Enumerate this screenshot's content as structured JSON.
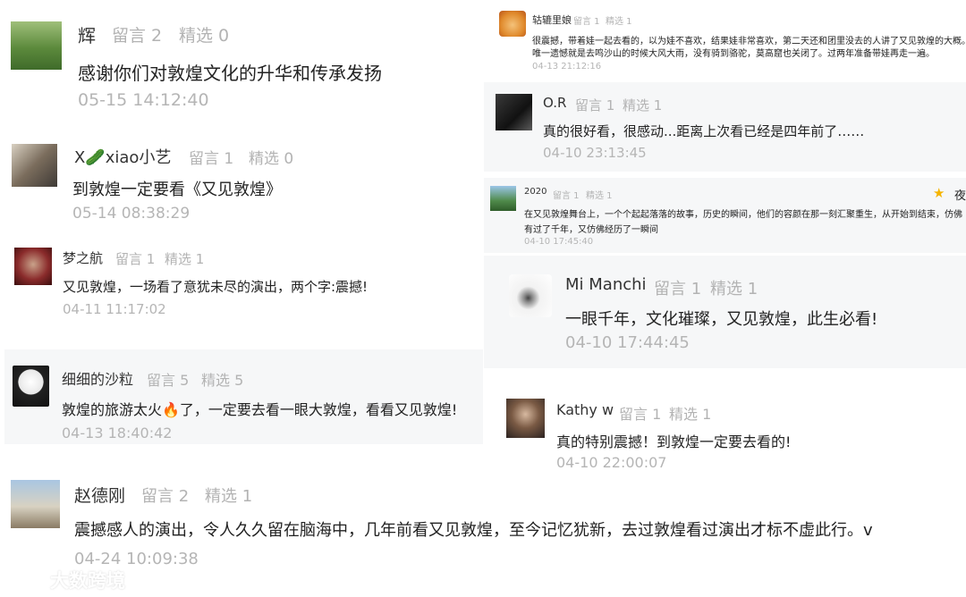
{
  "comments": [
    {
      "name": "辉",
      "meta_msgs": "留言 2",
      "meta_sel": "精选 0",
      "text": "感谢你们对敦煌文化的升华和传承发扬",
      "time": "05-15 14:12:40"
    },
    {
      "name": "X🥒xiao小艺",
      "meta_msgs": "留言 1",
      "meta_sel": "精选 0",
      "text": "到敦煌一定要看《又见敦煌》",
      "time": "05-14 08:38:29"
    },
    {
      "name": "梦之航",
      "meta_msgs": "留言 1",
      "meta_sel": "精选 1",
      "text": "又见敦煌，一场看了意犹未尽的演出，两个字:震撼!",
      "time": "04-11 11:17:02"
    },
    {
      "name": "细细的沙粒",
      "meta_msgs": "留言 5",
      "meta_sel": "精选 5",
      "text": "敦煌的旅游太火🔥了，一定要去看一眼大敦煌，看看又见敦煌!",
      "time": "04-13 18:40:42"
    },
    {
      "name": "赵德刚",
      "meta_msgs": "留言 2",
      "meta_sel": "精选 1",
      "text": "震撼感人的演出，令人久久留在脑海中，几年前看又见敦煌，至今记忆犹新，去过敦煌看过演出才标不虚此行。v",
      "time": "04-24 10:09:38"
    },
    {
      "name": "轱辘里娘",
      "meta_msgs": "留言 1",
      "meta_sel": "精选 1",
      "text": "很震撼，带着娃一起去看的，以为娃不喜欢，结果娃非常喜欢，第二天还和团里没去的人讲了又见敦煌的大概。",
      "text2": "唯一遗憾就是去鸣沙山的时候大风大雨，没有骑到骆驼，莫高窟也关闭了。过两年准备带娃再走一遍。",
      "time": "04-13 21:12:16"
    },
    {
      "name": "O.R",
      "meta_msgs": "留言 1",
      "meta_sel": "精选 1",
      "text": "真的很好看，很感动...距离上次看已经是四年前了……",
      "time": "04-10 23:13:45"
    },
    {
      "name": "2020",
      "meta_msgs": "留言 1",
      "meta_sel": "精选 1",
      "text": "在又见敦煌舞台上，一个个起起落落的故事，历史的瞬间，他们的容颜在那一刻汇聚重生，从开始到结束，仿佛",
      "text2": "有过了千年，又仿佛经历了一瞬间",
      "time": "04-10 17:45:40",
      "side_char": "夜"
    },
    {
      "name": "Mi Manchi",
      "meta_msgs": "留言 1",
      "meta_sel": "精选 1",
      "text": "一眼千年，文化璀璨，又见敦煌，此生必看!",
      "time": "04-10 17:44:45"
    },
    {
      "name": "Kathy w",
      "meta_msgs": "留言 1",
      "meta_sel": "精选 1",
      "text": "真的特别震撼！到敦煌一定要去看的!",
      "time": "04-10 22:00:07"
    }
  ],
  "watermark": "大数跨境",
  "colors": {
    "name": "#333333",
    "meta": "#b3b3b3",
    "text": "#222222",
    "time": "#b5b5b5",
    "card_gray": "#f6f7f8"
  }
}
